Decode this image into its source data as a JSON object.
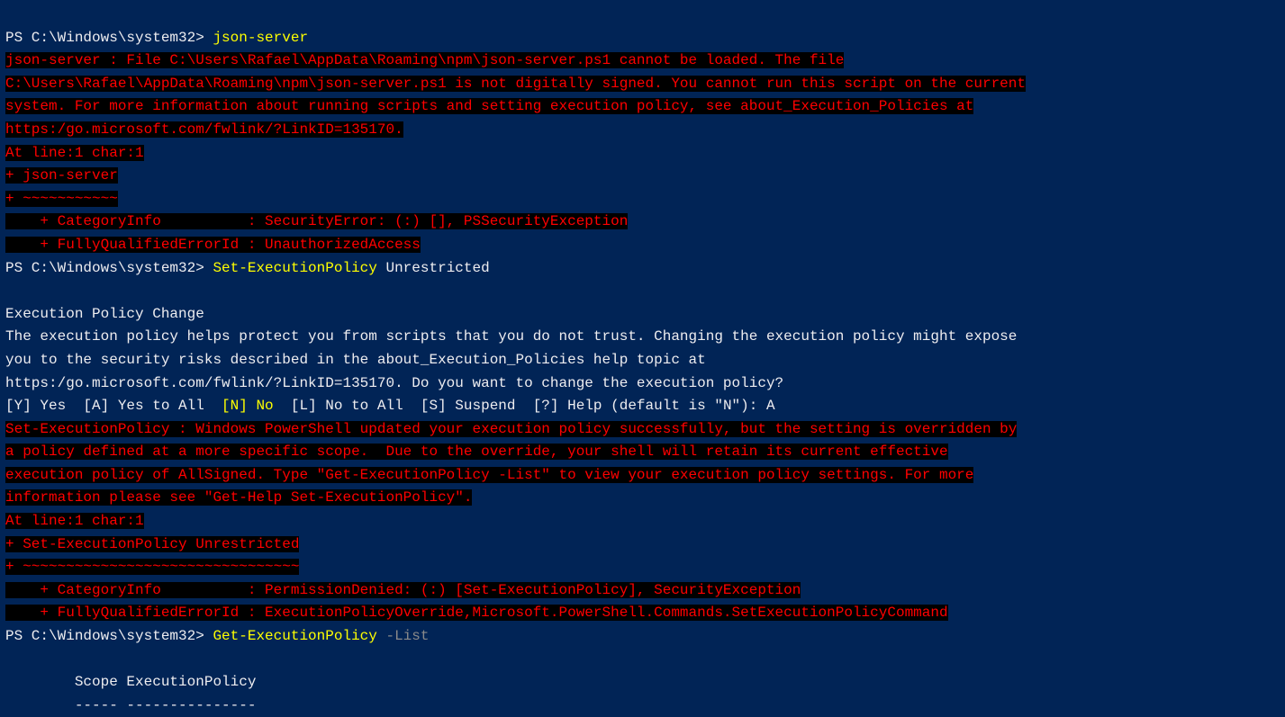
{
  "prompt": "PS C:\\Windows\\system32> ",
  "cmd1": {
    "command": "json-server",
    "error": "json-server : File C:\\Users\\Rafael\\AppData\\Roaming\\npm\\json-server.ps1 cannot be loaded. The file\nC:\\Users\\Rafael\\AppData\\Roaming\\npm\\json-server.ps1 is not digitally signed. You cannot run this script on the current\nsystem. For more information about running scripts and setting execution policy, see about_Execution_Policies at\nhttps:/go.microsoft.com/fwlink/?LinkID=135170.\nAt line:1 char:1\n+ json-server\n+ ~~~~~~~~~~~\n    + CategoryInfo          : SecurityError: (:) [], PSSecurityException\n    + FullyQualifiedErrorId : UnauthorizedAccess"
  },
  "cmd2": {
    "command": "Set-ExecutionPolicy",
    "argument": " Unrestricted",
    "blank": " ",
    "heading": "Execution Policy Change",
    "body": "The execution policy helps protect you from scripts that you do not trust. Changing the execution policy might expose\nyou to the security risks described in the about_Execution_Policies help topic at\nhttps:/go.microsoft.com/fwlink/?LinkID=135170. Do you want to change the execution policy?",
    "choices_pre": "[Y] Yes  [A] Yes to All  ",
    "default": "[N] No",
    "choices_post": "  [L] No to All  [S] Suspend  [?] Help (default is \"N\"): A",
    "error": "Set-ExecutionPolicy : Windows PowerShell updated your execution policy successfully, but the setting is overridden by\na policy defined at a more specific scope.  Due to the override, your shell will retain its current effective\nexecution policy of AllSigned. Type \"Get-ExecutionPolicy -List\" to view your execution policy settings. For more\ninformation please see \"Get-Help Set-ExecutionPolicy\".\nAt line:1 char:1\n+ Set-ExecutionPolicy Unrestricted\n+ ~~~~~~~~~~~~~~~~~~~~~~~~~~~~~~~~\n    + CategoryInfo          : PermissionDenied: (:) [Set-ExecutionPolicy], SecurityException\n    + FullyQualifiedErrorId : ExecutionPolicyOverride,Microsoft.PowerShell.Commands.SetExecutionPolicyCommand"
  },
  "cmd3": {
    "command": "Get-ExecutionPolicy",
    "flag": " -List",
    "blank": " ",
    "header": "        Scope ExecutionPolicy",
    "divider": "        ----- ---------------"
  }
}
